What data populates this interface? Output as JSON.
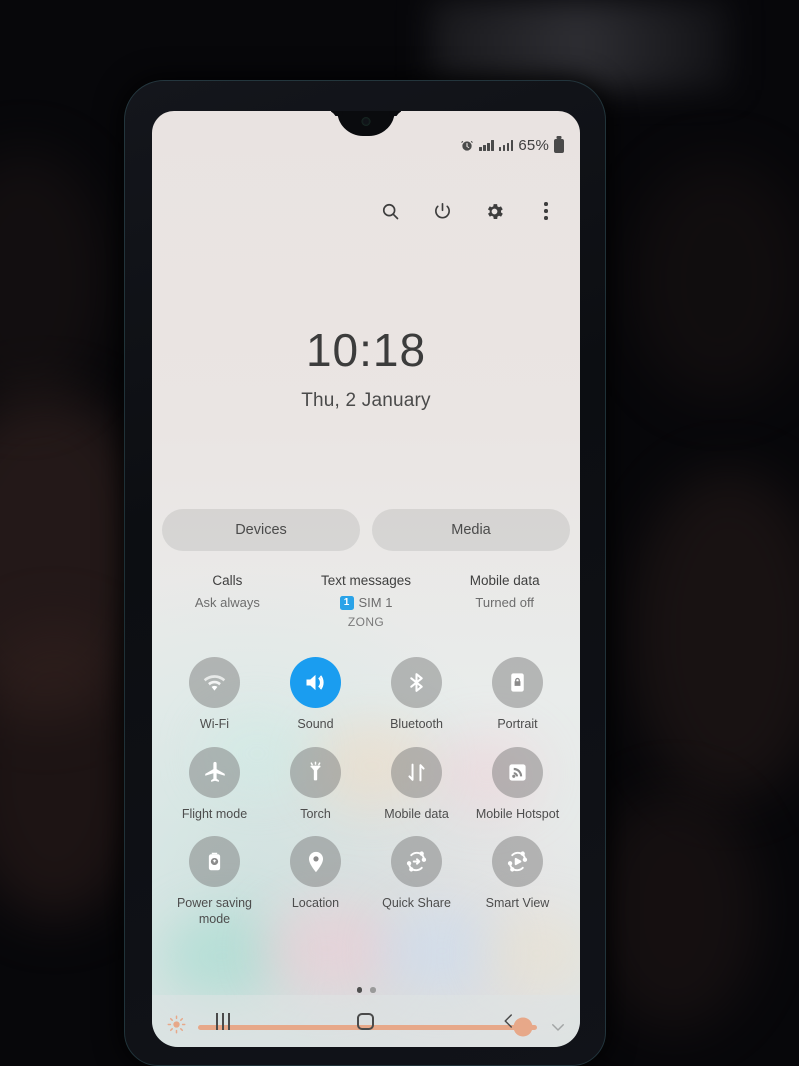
{
  "status_bar": {
    "alarm_icon": "alarm-icon",
    "signal_sim1_icon": "signal-bars-icon",
    "signal_sim2_icon": "signal-bars-icon",
    "battery_percent": "65%",
    "battery_icon": "battery-icon"
  },
  "top_actions": [
    {
      "name": "search-icon",
      "label": "Search"
    },
    {
      "name": "power-icon",
      "label": "Power"
    },
    {
      "name": "gear-icon",
      "label": "Settings"
    },
    {
      "name": "more-options-icon",
      "label": "More options"
    }
  ],
  "clock": {
    "time": "10:18",
    "date": "Thu, 2 January"
  },
  "pills": [
    {
      "label": "Devices"
    },
    {
      "label": "Media"
    }
  ],
  "sim_info": [
    {
      "label": "Calls",
      "value": "Ask always",
      "badge": "",
      "sub": ""
    },
    {
      "label": "Text messages",
      "value": "SIM 1",
      "badge": "1",
      "sub": "ZONG"
    },
    {
      "label": "Mobile data",
      "value": "Turned off",
      "badge": "",
      "sub": ""
    }
  ],
  "quick_toggles": [
    {
      "label": "Wi-Fi",
      "icon": "wifi-icon",
      "active": false
    },
    {
      "label": "Sound",
      "icon": "sound-icon",
      "active": true
    },
    {
      "label": "Bluetooth",
      "icon": "bluetooth-icon",
      "active": false
    },
    {
      "label": "Portrait",
      "icon": "rotation-lock-icon",
      "active": false
    },
    {
      "label": "Flight mode",
      "icon": "airplane-icon",
      "active": false
    },
    {
      "label": "Torch",
      "icon": "flashlight-icon",
      "active": false
    },
    {
      "label": "Mobile data",
      "icon": "mobile-data-icon",
      "active": false
    },
    {
      "label": "Mobile Hotspot",
      "icon": "hotspot-icon",
      "active": false
    },
    {
      "label": "Power saving mode",
      "icon": "power-saving-icon",
      "active": false
    },
    {
      "label": "Location",
      "icon": "location-pin-icon",
      "active": false
    },
    {
      "label": "Quick Share",
      "icon": "quick-share-icon",
      "active": false
    },
    {
      "label": "Smart View",
      "icon": "smart-view-icon",
      "active": false
    }
  ],
  "pagination": {
    "total": 2,
    "active_index": 0
  },
  "brightness": {
    "icon": "brightness-icon",
    "value_percent": 96,
    "expand_icon": "chevron-down-icon",
    "slider_color": "#f2601b"
  },
  "nav_bar": [
    {
      "name": "recents-button",
      "label": "Recents"
    },
    {
      "name": "home-button",
      "label": "Home"
    },
    {
      "name": "back-button",
      "label": "Back"
    }
  ],
  "colors": {
    "accent_blue": "#1a9df0",
    "accent_orange": "#f2601b",
    "tile_grey": "rgba(118,118,118,.46)",
    "screen_bg": "#e9e3e1"
  }
}
